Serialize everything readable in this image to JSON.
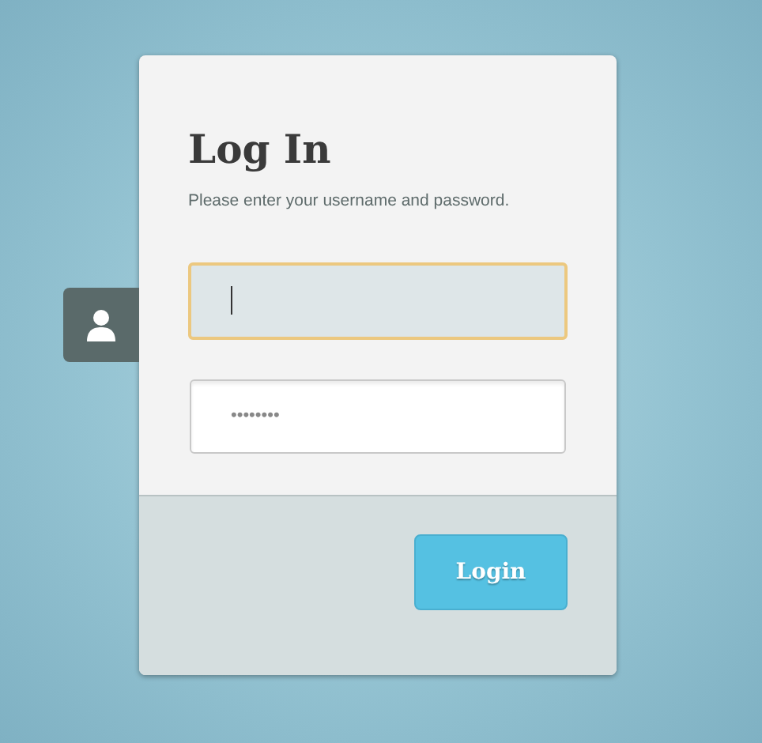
{
  "title": "Log In",
  "subtitle": "Please enter your username and password.",
  "fields": [
    {
      "focused": true
    },
    {
      "value": "••••••••",
      "focused": false
    }
  ],
  "submit": "Login"
}
